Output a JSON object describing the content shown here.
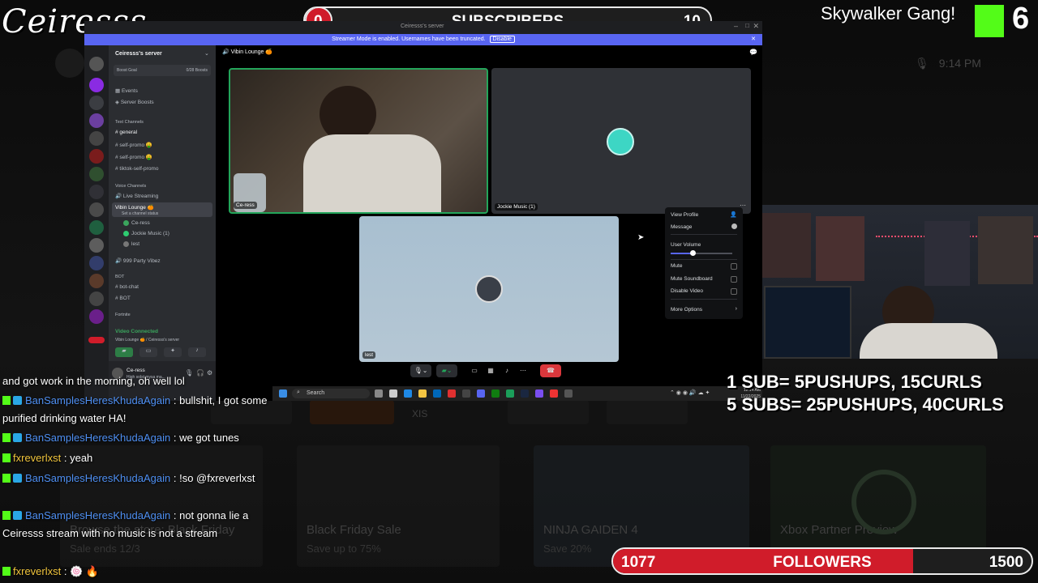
{
  "background": {
    "tiles": [
      {
        "title": "Browse the store: Black Friday",
        "subtitle": "Sale ends 12/3"
      },
      {
        "title": "Black Friday Sale",
        "subtitle": "Save up to 75%"
      },
      {
        "title": "NINJA GAIDEN 4",
        "subtitle": "Save 20%"
      },
      {
        "title": "Xbox Partner Preview",
        "subtitle": ""
      }
    ],
    "tile_badge": "XIS",
    "clock": "9:14 PM"
  },
  "overlay": {
    "brand": "Ceiresss",
    "subscribers": {
      "current": "0",
      "label": "SUBSCRIBERS",
      "goal": "10",
      "progress": 0.0
    },
    "followers": {
      "current": "1077",
      "label": "FOLLOWERS",
      "goal": "1500",
      "progress": 0.718
    },
    "gang_label": "Skywalker Gang!",
    "kick_count": "6",
    "pushups_line1": "1 SUB= 5PUSHUPS, 15CURLS",
    "pushups_line2": "5 SUBS= 25PUSHUPS, 40CURLS"
  },
  "discord": {
    "window_title": "Ceiresss's server",
    "streamer_banner": "Streamer Mode is enabled. Usernames have been truncated.",
    "streamer_disable": "Disable",
    "server_name": "Ceiresss's server",
    "boost_goal": "Boost Goal",
    "boost_count": "0/28 Boosts",
    "events": "Events",
    "server_boosts": "Server Boosts",
    "text_header": "Text Channels",
    "text_channels": [
      "general",
      "self-promo 🤑",
      "self-promo 🤑",
      "tiktok-self-promo"
    ],
    "voice_header": "Voice Channels",
    "live_streaming": "Live Streaming",
    "vibin_lounge": "Vibin Lounge 🍊",
    "set_status": "Set a channel status",
    "voice_members": [
      "Ce-ress",
      "Jockie Music (1)",
      "lest"
    ],
    "party_vibez": "999 Party Vibez",
    "bot_header": "BOT",
    "bot_channels": [
      "bot-chat",
      "BOT"
    ],
    "fortnite": "Fortnite",
    "video_connected": "Video Connected",
    "vc_sub": "Vibin Lounge 🍊 / Ceiresss's server",
    "user_name": "Ce-ress",
    "user_status": "High solst mysa ma...",
    "channel_title": "Vibin Lounge 🍊",
    "tiles": [
      {
        "label": "Ce-ress"
      },
      {
        "label": "Jockie Music (1)"
      },
      {
        "label": "lest"
      }
    ],
    "context_menu": [
      "View Profile",
      "Message",
      "User Volume",
      "Mute",
      "Mute Soundboard",
      "Disable Video",
      "More Options"
    ],
    "user_volume": 0.35
  },
  "taskbar": {
    "search": "Search",
    "time": "12:14 AM",
    "date": "11/22/2025"
  },
  "chat": [
    {
      "user": "",
      "text": "and got work in the morning, oh well lol",
      "badges": false
    },
    {
      "user": "BanSamplesHeresKhudaAgain",
      "text": ": bullshit, I got some purified drinking water HA!",
      "badges": true,
      "color": "a"
    },
    {
      "user": "BanSamplesHeresKhudaAgain",
      "text": ": we got tunes",
      "badges": true,
      "color": "a"
    },
    {
      "user": "fxreverlxst",
      "text": ": yeah",
      "badges": false,
      "color": "b"
    },
    {
      "user": "BanSamplesHeresKhudaAgain",
      "text": ": !so @fxreverlxst",
      "badges": true,
      "color": "a"
    },
    {
      "user": "BanSamplesHeresKhudaAgain",
      "text": ": not gonna lie a Ceiresss stream with no music is not a stream",
      "badges": true,
      "color": "a"
    },
    {
      "user": "fxreverlxst",
      "text": ": 🍥 🔥",
      "badges": false,
      "color": "b"
    }
  ],
  "colors": {
    "accent_red": "#d01c2a",
    "kick_green": "#53fc18",
    "discord_blurple": "#5865f2",
    "chat_blue": "#4e8ff2",
    "chat_gold": "#f0c43c"
  }
}
